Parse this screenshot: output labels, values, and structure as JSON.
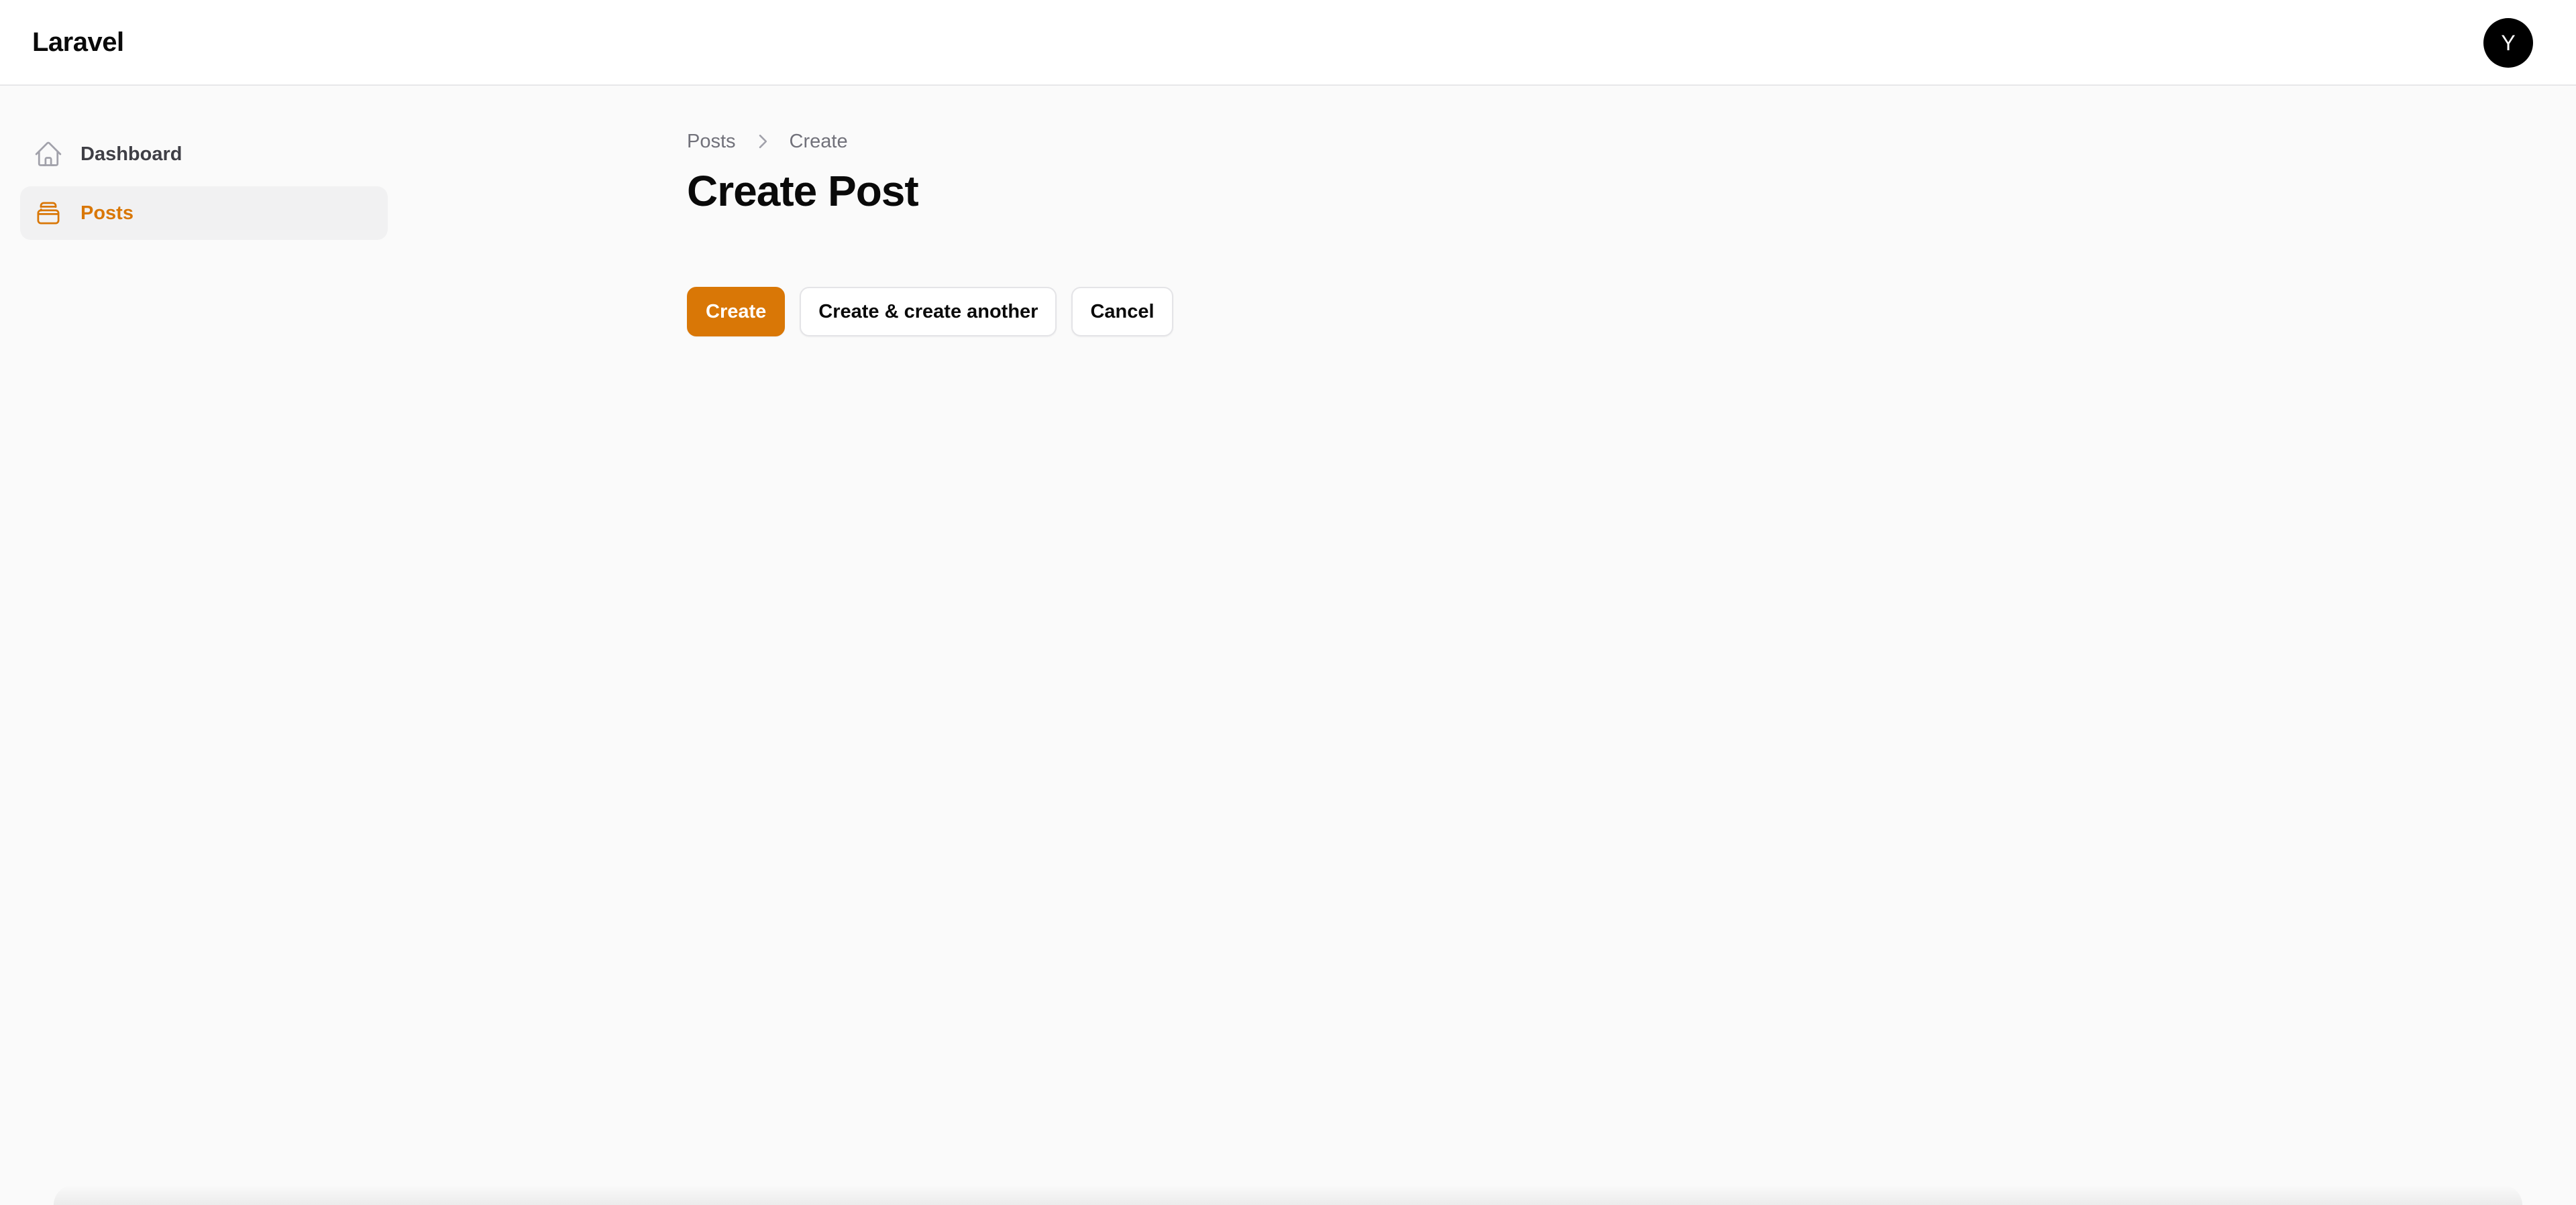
{
  "app": {
    "brand": "Laravel",
    "avatar_initial": "Y"
  },
  "sidebar": {
    "items": [
      {
        "label": "Dashboard",
        "icon": "home-icon",
        "active": false
      },
      {
        "label": "Posts",
        "icon": "inbox-stack-icon",
        "active": true
      }
    ]
  },
  "breadcrumb": {
    "items": [
      "Posts",
      "Create"
    ],
    "separator_icon": "chevron-right-icon"
  },
  "main": {
    "title": "Create Post"
  },
  "actions": {
    "create_label": "Create",
    "create_another_label": "Create & create another",
    "cancel_label": "Cancel"
  },
  "colors": {
    "accent": "#d97706",
    "background": "#fafafa",
    "topbar": "#ffffff",
    "text": "#0a0a0a",
    "muted": "#71717a"
  }
}
